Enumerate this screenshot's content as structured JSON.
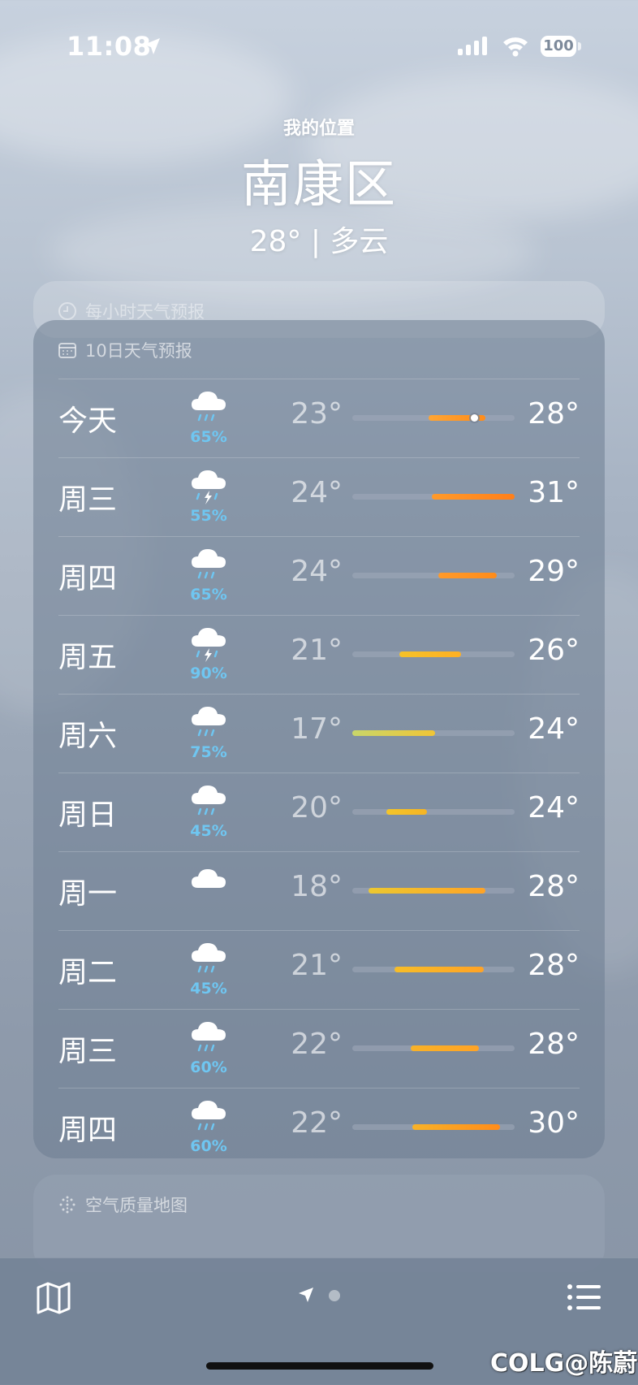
{
  "status_bar": {
    "time": "11:08",
    "battery": "100"
  },
  "header": {
    "subtitle": "我的位置",
    "city": "南康区",
    "summary": "28° | 多云"
  },
  "hourly_card": {
    "title": "每小时天气预报"
  },
  "forecast": {
    "title": "10日天气预报",
    "days": [
      {
        "day": "今天",
        "icon": "rain-cloud-icon",
        "precip": "65%",
        "low": "23°",
        "high": "28°",
        "bar_start": 0.47,
        "bar_end": 0.82,
        "bar_from": "#ffa533",
        "bar_to": "#ff8c1a",
        "current_pos": 0.75
      },
      {
        "day": "周三",
        "icon": "thunderstorm-icon",
        "precip": "55%",
        "low": "24°",
        "high": "31°",
        "bar_start": 0.49,
        "bar_end": 1.0,
        "bar_from": "#ff9a2a",
        "bar_to": "#ff7f1a"
      },
      {
        "day": "周四",
        "icon": "rain-cloud-icon",
        "precip": "65%",
        "low": "24°",
        "high": "29°",
        "bar_start": 0.53,
        "bar_end": 0.89,
        "bar_from": "#ff9a2a",
        "bar_to": "#ff8c1a"
      },
      {
        "day": "周五",
        "icon": "thunderstorm-icon",
        "precip": "90%",
        "low": "21°",
        "high": "26°",
        "bar_start": 0.29,
        "bar_end": 0.67,
        "bar_from": "#f5c229",
        "bar_to": "#ffb023"
      },
      {
        "day": "周六",
        "icon": "rain-cloud-icon",
        "precip": "75%",
        "low": "17°",
        "high": "24°",
        "bar_start": 0.0,
        "bar_end": 0.51,
        "bar_from": "#c9d66a",
        "bar_to": "#f0c536"
      },
      {
        "day": "周日",
        "icon": "rain-cloud-icon",
        "precip": "45%",
        "low": "20°",
        "high": "24°",
        "bar_start": 0.21,
        "bar_end": 0.46,
        "bar_from": "#f3c52a",
        "bar_to": "#f5b424"
      },
      {
        "day": "周一",
        "icon": "cloud-icon",
        "precip": "",
        "low": "18°",
        "high": "28°",
        "bar_start": 0.1,
        "bar_end": 0.82,
        "bar_from": "#ecc830",
        "bar_to": "#ffa326"
      },
      {
        "day": "周二",
        "icon": "rain-cloud-icon",
        "precip": "45%",
        "low": "21°",
        "high": "28°",
        "bar_start": 0.26,
        "bar_end": 0.81,
        "bar_from": "#f6bd28",
        "bar_to": "#ffa326"
      },
      {
        "day": "周三",
        "icon": "rain-cloud-icon",
        "precip": "60%",
        "low": "22°",
        "high": "28°",
        "bar_start": 0.36,
        "bar_end": 0.78,
        "bar_from": "#f8b228",
        "bar_to": "#ffa326"
      },
      {
        "day": "周四",
        "icon": "rain-cloud-icon",
        "precip": "60%",
        "low": "22°",
        "high": "30°",
        "bar_start": 0.37,
        "bar_end": 0.91,
        "bar_from": "#f8b228",
        "bar_to": "#ff8c1a"
      }
    ]
  },
  "air_quality": {
    "title": "空气质量地图"
  },
  "watermark": "COLG@陈蔚",
  "colors": {
    "precip": "#6fc6f1",
    "card": "#6e7e92",
    "toolbar": "#768498"
  }
}
